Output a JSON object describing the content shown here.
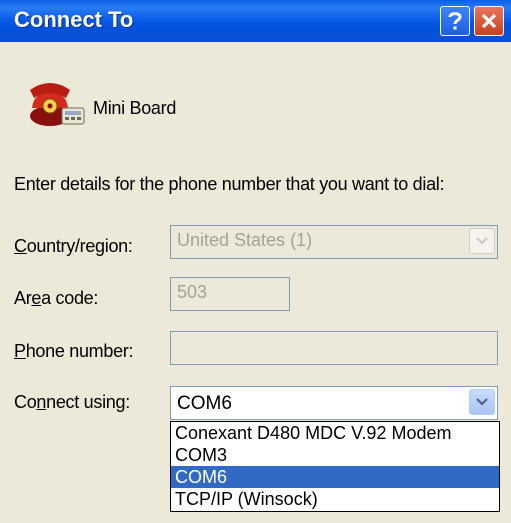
{
  "window": {
    "title": "Connect To"
  },
  "connection": {
    "name": "Mini Board"
  },
  "instructions": "Enter details for the phone number that you want to dial:",
  "fields": {
    "country": {
      "label_pre": "",
      "label_u": "C",
      "label_post": "ountry/region:",
      "value": "United States (1)"
    },
    "area": {
      "label_pre": "Ar",
      "label_u": "e",
      "label_post": "a code:",
      "value": "503"
    },
    "phone": {
      "label_pre": "",
      "label_u": "P",
      "label_post": "hone number:",
      "value": ""
    },
    "connect": {
      "label_pre": "Co",
      "label_u": "n",
      "label_post": "nect using:",
      "value": "COM6"
    }
  },
  "connect_options": [
    "Conexant D480 MDC V.92 Modem",
    "COM3",
    "COM6",
    "TCP/IP (Winsock)"
  ],
  "colors": {
    "title_bar": "#0054e3",
    "selection": "#316ac5",
    "dialog_bg": "#ece9d8"
  }
}
